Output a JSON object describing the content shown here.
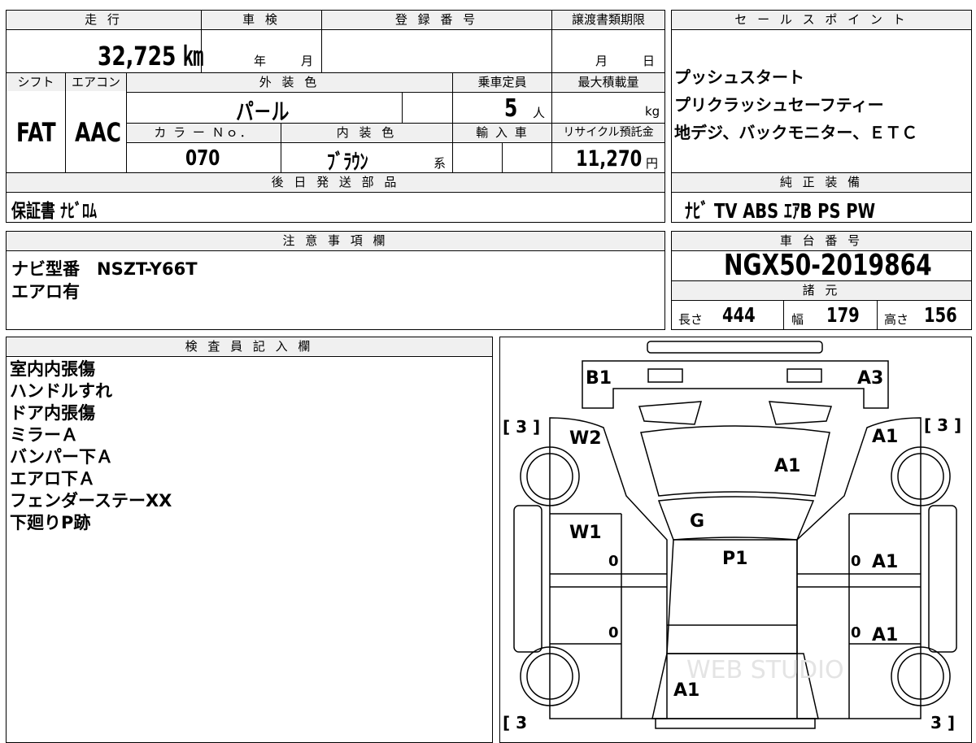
{
  "top": {
    "mileage_label": "走 行",
    "mileage_value": "32,725 ㎞",
    "inspection_label": "車 検",
    "inspection_year": "年",
    "inspection_month": "月",
    "registration_label": "登 録 番 号",
    "transfer_label": "譲渡書類期限",
    "transfer_month": "月",
    "transfer_day": "日",
    "shift_label": "シフト",
    "shift_value": "FAT",
    "ac_label": "エアコン",
    "ac_value": "AAC",
    "exterior_label": "外 装 色",
    "exterior_value": "パ－ル",
    "capacity_label": "乗車定員",
    "capacity_value": "5",
    "capacity_unit": "人",
    "maxload_label": "最大積載量",
    "maxload_unit": "kg",
    "color_no_label": "カ ラ ー Ｎｏ．",
    "color_no_value": "070",
    "interior_label": "内 装 色",
    "interior_value": "ﾌﾞﾗｳﾝ",
    "interior_suffix": "系",
    "import_label": "輸 入 車",
    "recycle_label": "リサイクル預託金",
    "recycle_value": "11,270",
    "recycle_unit": "円",
    "later_parts_label": "後 日 発 送 部 品",
    "later_parts_value": "保証書 ﾅﾋﾞﾛﾑ"
  },
  "sales": {
    "label": "セ ー ル ス ポ イ ン ト",
    "lines": [
      "プッシュスタート",
      "プリクラッシュセーフティー",
      "地デジ、バックモニター、ＥＴＣ"
    ],
    "genuine_label": "純 正 装 備",
    "genuine_value": "ﾅﾋﾞ TV ABS ｴｱB PS PW"
  },
  "notes": {
    "label": "注 意 事 項 欄",
    "line1": "ナビ型番　NSZT-Y66T",
    "line2": "エアロ有"
  },
  "chassis": {
    "label": "車 台 番 号",
    "value": "NGX50-2019864",
    "specs_label": "諸 元",
    "length_label": "長さ",
    "length_value": "444",
    "width_label": "幅",
    "width_value": "179",
    "height_label": "高さ",
    "height_value": "156"
  },
  "inspector": {
    "label": "検 査 員 記 入 欄",
    "items": [
      "室内内張傷",
      "ハンドルすれ",
      "ドア内張傷",
      "ミラーＡ",
      "バンパー下Ａ",
      "エアロ下Ａ",
      "フェンダーステーXX",
      "下廻りP跡"
    ]
  },
  "diagram": {
    "marks": {
      "b1": "B1",
      "a3": "A3",
      "w2": "W2",
      "a1_fr": "A1",
      "a1_hood": "A1",
      "g": "G",
      "w1": "W1",
      "p1": "P1",
      "a1_rd1": "A1",
      "a1_rd2": "A1",
      "a1_rear": "A1",
      "zero1": "0",
      "zero2": "0",
      "zero3": "0",
      "zero4": "0"
    },
    "tire_tl": "[ 3 ]",
    "tire_tr": "[ 3 ]",
    "tire_bl": "[ 3",
    "tire_br": "3 ]",
    "watermark": "WEB STUDIO"
  }
}
